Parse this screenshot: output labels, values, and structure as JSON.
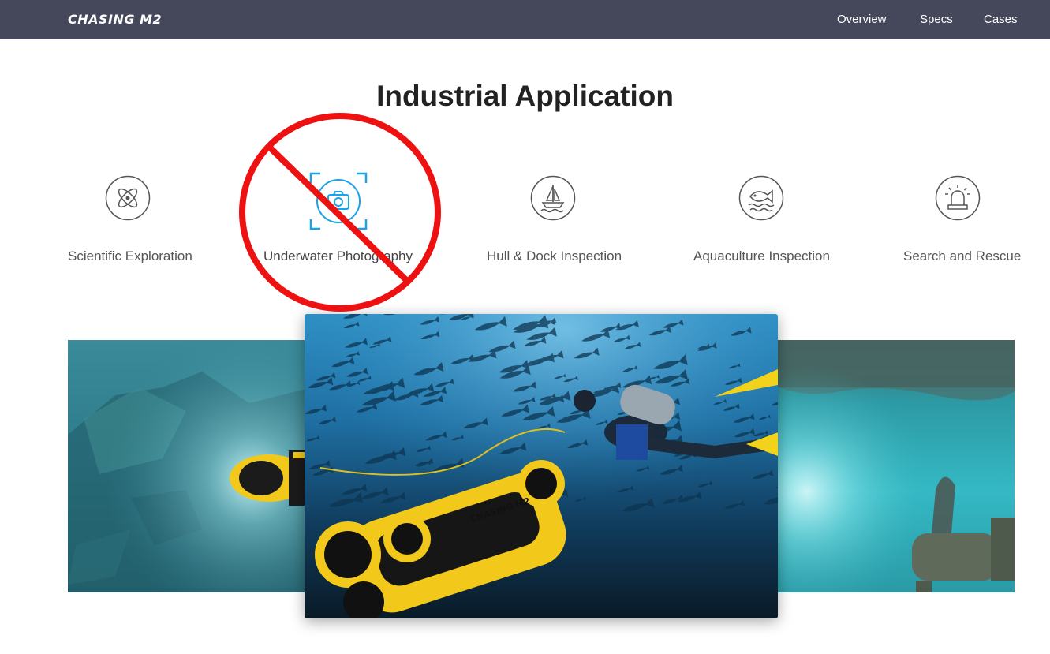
{
  "header": {
    "logo": "CHASING M2",
    "nav": [
      {
        "label": "Overview"
      },
      {
        "label": "Specs"
      },
      {
        "label": "Cases"
      }
    ]
  },
  "section": {
    "title": "Industrial Application"
  },
  "applications": [
    {
      "label": "Scientific Exploration",
      "icon": "atom-icon",
      "active": false
    },
    {
      "label": "Underwater Photography",
      "icon": "camera-icon",
      "active": true
    },
    {
      "label": "Hull & Dock Inspection",
      "icon": "sailboat-icon",
      "active": false
    },
    {
      "label": "Aquaculture Inspection",
      "icon": "fish-icon",
      "active": false
    },
    {
      "label": "Search and Rescue",
      "icon": "alarm-light-icon",
      "active": false
    }
  ],
  "gallery": {
    "drone_label": "CHASING M2",
    "slides": [
      {
        "name": "shipwreck-exploration"
      },
      {
        "name": "diver-with-drone"
      },
      {
        "name": "hull-inspection"
      }
    ]
  },
  "colors": {
    "nav_bg": "#45475a",
    "active_icon": "#1aa3e8",
    "overlay_red": "#ee1111",
    "drone_yellow": "#f2c81a"
  }
}
